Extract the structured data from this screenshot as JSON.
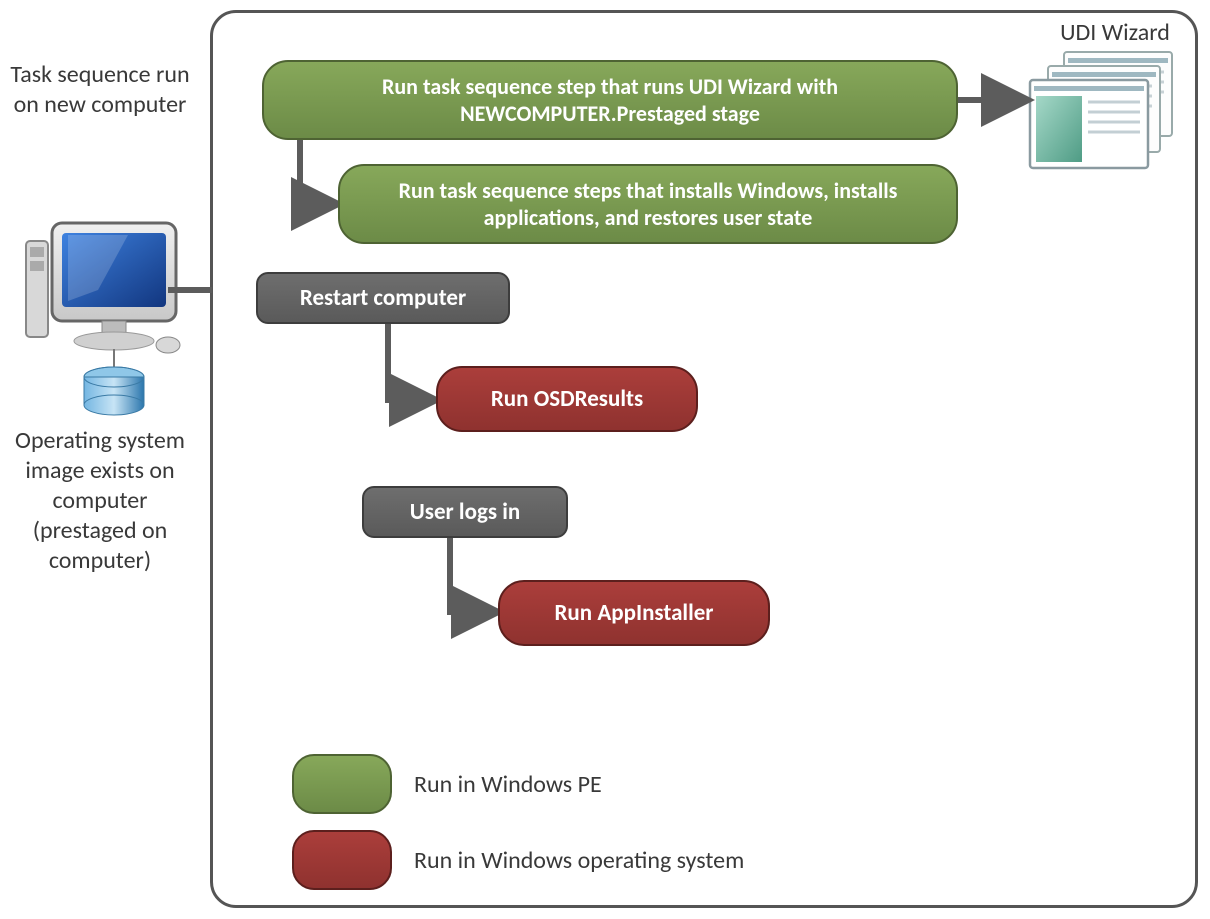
{
  "left_annotations": {
    "top": "Task sequence run on new computer",
    "bottom": "Operating system image exists on computer (prestaged on computer)"
  },
  "udi_wizard_label": "UDI Wizard",
  "nodes": {
    "step1": "Run task sequence step  that runs UDI Wizard with NEWCOMPUTER.Prestaged  stage",
    "step2": "Run task sequence steps that installs Windows, installs  applications, and restores user state",
    "restart": "Restart computer",
    "osd": "Run OSDResults",
    "userlogs": "User logs in",
    "appinstaller": "Run AppInstaller"
  },
  "legend": {
    "pe": "Run in Windows  PE",
    "os": "Run in Windows operating system"
  },
  "colors": {
    "green": "#779a4f",
    "green_border": "#4e6333",
    "gray": "#636363",
    "gray_border": "#3d3d3d",
    "red": "#9c3834",
    "red_border": "#5c1f1d",
    "wizard_teal": "#77b9a6",
    "monitor_blue": "#1f5fb5",
    "cylinder_blue": "#3e8bc4"
  }
}
